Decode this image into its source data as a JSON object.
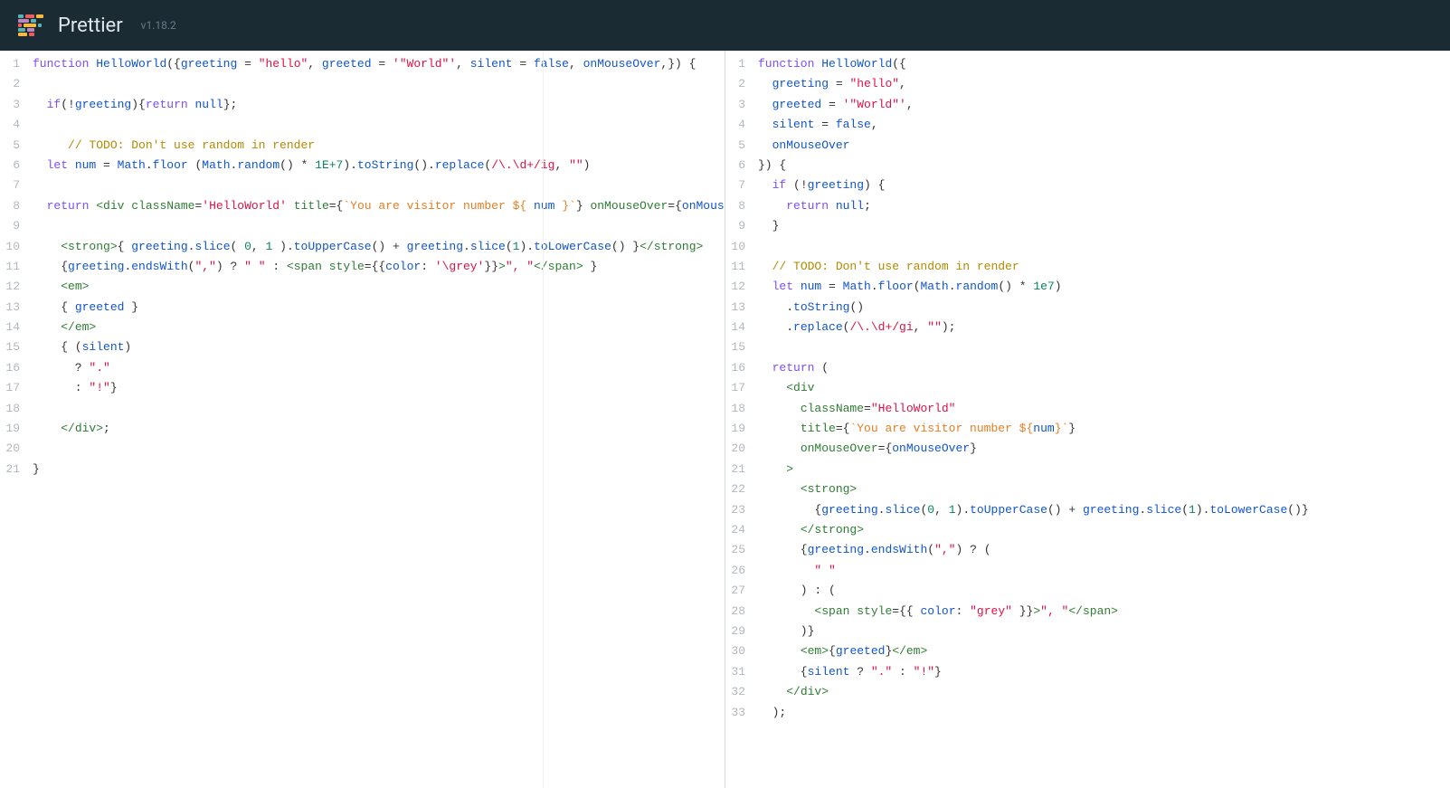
{
  "header": {
    "brand": "Prettier",
    "version": "v1.18.2"
  },
  "leftCode": [
    [
      [
        "kw",
        "function"
      ],
      [
        "op",
        " "
      ],
      [
        "fn",
        "HelloWorld"
      ],
      [
        "op",
        "({"
      ],
      [
        "id",
        "greeting"
      ],
      [
        "op",
        " = "
      ],
      [
        "str",
        "\"hello\""
      ],
      [
        "op",
        ", "
      ],
      [
        "id",
        "greeted"
      ],
      [
        "op",
        " = "
      ],
      [
        "str",
        "'\"World\"'"
      ],
      [
        "op",
        ", "
      ],
      [
        "id",
        "silent"
      ],
      [
        "op",
        " = "
      ],
      [
        "bool",
        "false"
      ],
      [
        "op",
        ", "
      ],
      [
        "id",
        "onMouseOver"
      ],
      [
        "op",
        ",}) {"
      ]
    ],
    [],
    [
      [
        "op",
        "  "
      ],
      [
        "kw",
        "if"
      ],
      [
        "op",
        "(!"
      ],
      [
        "id",
        "greeting"
      ],
      [
        "op",
        "){"
      ],
      [
        "kw",
        "return"
      ],
      [
        "op",
        " "
      ],
      [
        "bool",
        "null"
      ],
      [
        "op",
        "};"
      ]
    ],
    [],
    [
      [
        "op",
        "     "
      ],
      [
        "cm",
        "// TODO: Don't use random in render"
      ]
    ],
    [
      [
        "op",
        "  "
      ],
      [
        "kw",
        "let"
      ],
      [
        "op",
        " "
      ],
      [
        "id",
        "num"
      ],
      [
        "op",
        " = "
      ],
      [
        "id",
        "Math"
      ],
      [
        "op",
        "."
      ],
      [
        "prop",
        "floor"
      ],
      [
        "op",
        " ("
      ],
      [
        "id",
        "Math"
      ],
      [
        "op",
        "."
      ],
      [
        "prop",
        "random"
      ],
      [
        "op",
        "() * "
      ],
      [
        "num",
        "1E+7"
      ],
      [
        "op",
        ")."
      ],
      [
        "prop",
        "toString"
      ],
      [
        "op",
        "()."
      ],
      [
        "prop",
        "replace"
      ],
      [
        "op",
        "("
      ],
      [
        "regex",
        "/\\.\\d+/ig"
      ],
      [
        "op",
        ", "
      ],
      [
        "str",
        "\"\""
      ],
      [
        "op",
        ")"
      ]
    ],
    [],
    [
      [
        "op",
        "  "
      ],
      [
        "kw",
        "return"
      ],
      [
        "op",
        " "
      ],
      [
        "tag",
        "<div"
      ],
      [
        "op",
        " "
      ],
      [
        "attr",
        "className"
      ],
      [
        "op",
        "="
      ],
      [
        "str",
        "'HelloWorld'"
      ],
      [
        "op",
        " "
      ],
      [
        "attr",
        "title"
      ],
      [
        "op",
        "={"
      ],
      [
        "str2",
        "`You are visitor number ${"
      ],
      [
        "op",
        " "
      ],
      [
        "id",
        "num"
      ],
      [
        "op",
        " "
      ],
      [
        "str2",
        "}`"
      ],
      [
        "op",
        "} "
      ],
      [
        "attr",
        "onMouseOver"
      ],
      [
        "op",
        "={"
      ],
      [
        "id",
        "onMouseOver"
      ],
      [
        "op",
        "}"
      ],
      [
        "tag",
        ">"
      ]
    ],
    [],
    [
      [
        "op",
        "    "
      ],
      [
        "tag",
        "<strong>"
      ],
      [
        "op",
        "{ "
      ],
      [
        "id",
        "greeting"
      ],
      [
        "op",
        "."
      ],
      [
        "prop",
        "slice"
      ],
      [
        "op",
        "( "
      ],
      [
        "num",
        "0"
      ],
      [
        "op",
        ", "
      ],
      [
        "num",
        "1"
      ],
      [
        "op",
        " )."
      ],
      [
        "prop",
        "toUpperCase"
      ],
      [
        "op",
        "() + "
      ],
      [
        "id",
        "greeting"
      ],
      [
        "op",
        "."
      ],
      [
        "prop",
        "slice"
      ],
      [
        "op",
        "("
      ],
      [
        "num",
        "1"
      ],
      [
        "op",
        ")."
      ],
      [
        "prop",
        "toLowerCase"
      ],
      [
        "op",
        "() }"
      ],
      [
        "tag",
        "</strong>"
      ]
    ],
    [
      [
        "op",
        "    {"
      ],
      [
        "id",
        "greeting"
      ],
      [
        "op",
        "."
      ],
      [
        "prop",
        "endsWith"
      ],
      [
        "op",
        "("
      ],
      [
        "str",
        "\",\""
      ],
      [
        "op",
        ") ? "
      ],
      [
        "str",
        "\" \""
      ],
      [
        "op",
        " : "
      ],
      [
        "tag",
        "<span"
      ],
      [
        "op",
        " "
      ],
      [
        "attr",
        "style"
      ],
      [
        "op",
        "={{"
      ],
      [
        "id",
        "color"
      ],
      [
        "op",
        ": "
      ],
      [
        "str",
        "'\\grey'"
      ],
      [
        "op",
        "}}"
      ],
      [
        "tag",
        ">"
      ],
      [
        "str",
        "\", \""
      ],
      [
        "tag",
        "</span>"
      ],
      [
        "op",
        " }"
      ]
    ],
    [
      [
        "op",
        "    "
      ],
      [
        "tag",
        "<em>"
      ]
    ],
    [
      [
        "op",
        "    { "
      ],
      [
        "id",
        "greeted"
      ],
      [
        "op",
        " }"
      ]
    ],
    [
      [
        "op",
        "    "
      ],
      [
        "tag",
        "</em>"
      ]
    ],
    [
      [
        "op",
        "    { ("
      ],
      [
        "id",
        "silent"
      ],
      [
        "op",
        ")"
      ]
    ],
    [
      [
        "op",
        "      ? "
      ],
      [
        "str",
        "\".\""
      ]
    ],
    [
      [
        "op",
        "      : "
      ],
      [
        "str",
        "\"!\""
      ],
      [
        "op",
        "}"
      ]
    ],
    [],
    [
      [
        "op",
        "    "
      ],
      [
        "tag",
        "</div>"
      ],
      [
        "op",
        ";"
      ]
    ],
    [],
    [
      [
        "op",
        "}"
      ]
    ]
  ],
  "rightCode": [
    [
      [
        "kw",
        "function"
      ],
      [
        "op",
        " "
      ],
      [
        "fn",
        "HelloWorld"
      ],
      [
        "op",
        "({"
      ]
    ],
    [
      [
        "op",
        "  "
      ],
      [
        "id",
        "greeting"
      ],
      [
        "op",
        " = "
      ],
      [
        "str",
        "\"hello\""
      ],
      [
        "op",
        ","
      ]
    ],
    [
      [
        "op",
        "  "
      ],
      [
        "id",
        "greeted"
      ],
      [
        "op",
        " = "
      ],
      [
        "str",
        "'\"World\"'"
      ],
      [
        "op",
        ","
      ]
    ],
    [
      [
        "op",
        "  "
      ],
      [
        "id",
        "silent"
      ],
      [
        "op",
        " = "
      ],
      [
        "bool",
        "false"
      ],
      [
        "op",
        ","
      ]
    ],
    [
      [
        "op",
        "  "
      ],
      [
        "id",
        "onMouseOver"
      ]
    ],
    [
      [
        "op",
        "}) {"
      ]
    ],
    [
      [
        "op",
        "  "
      ],
      [
        "kw",
        "if"
      ],
      [
        "op",
        " (!"
      ],
      [
        "id",
        "greeting"
      ],
      [
        "op",
        ") {"
      ]
    ],
    [
      [
        "op",
        "    "
      ],
      [
        "kw",
        "return"
      ],
      [
        "op",
        " "
      ],
      [
        "bool",
        "null"
      ],
      [
        "op",
        ";"
      ]
    ],
    [
      [
        "op",
        "  }"
      ]
    ],
    [],
    [
      [
        "op",
        "  "
      ],
      [
        "cm",
        "// TODO: Don't use random in render"
      ]
    ],
    [
      [
        "op",
        "  "
      ],
      [
        "kw",
        "let"
      ],
      [
        "op",
        " "
      ],
      [
        "id",
        "num"
      ],
      [
        "op",
        " = "
      ],
      [
        "id",
        "Math"
      ],
      [
        "op",
        "."
      ],
      [
        "prop",
        "floor"
      ],
      [
        "op",
        "("
      ],
      [
        "id",
        "Math"
      ],
      [
        "op",
        "."
      ],
      [
        "prop",
        "random"
      ],
      [
        "op",
        "() * "
      ],
      [
        "num",
        "1e7"
      ],
      [
        "op",
        ")"
      ]
    ],
    [
      [
        "op",
        "    ."
      ],
      [
        "prop",
        "toString"
      ],
      [
        "op",
        "()"
      ]
    ],
    [
      [
        "op",
        "    ."
      ],
      [
        "prop",
        "replace"
      ],
      [
        "op",
        "("
      ],
      [
        "regex",
        "/\\.\\d+/gi"
      ],
      [
        "op",
        ", "
      ],
      [
        "str",
        "\"\""
      ],
      [
        "op",
        ");"
      ]
    ],
    [],
    [
      [
        "op",
        "  "
      ],
      [
        "kw",
        "return"
      ],
      [
        "op",
        " ("
      ]
    ],
    [
      [
        "op",
        "    "
      ],
      [
        "tag",
        "<div"
      ]
    ],
    [
      [
        "op",
        "      "
      ],
      [
        "attr",
        "className"
      ],
      [
        "op",
        "="
      ],
      [
        "str",
        "\"HelloWorld\""
      ]
    ],
    [
      [
        "op",
        "      "
      ],
      [
        "attr",
        "title"
      ],
      [
        "op",
        "={"
      ],
      [
        "str2",
        "`You are visitor number ${"
      ],
      [
        "id",
        "num"
      ],
      [
        "str2",
        "}`"
      ],
      [
        "op",
        "}"
      ]
    ],
    [
      [
        "op",
        "      "
      ],
      [
        "attr",
        "onMouseOver"
      ],
      [
        "op",
        "={"
      ],
      [
        "id",
        "onMouseOver"
      ],
      [
        "op",
        "}"
      ]
    ],
    [
      [
        "op",
        "    "
      ],
      [
        "tag",
        ">"
      ]
    ],
    [
      [
        "op",
        "      "
      ],
      [
        "tag",
        "<strong>"
      ]
    ],
    [
      [
        "op",
        "        {"
      ],
      [
        "id",
        "greeting"
      ],
      [
        "op",
        "."
      ],
      [
        "prop",
        "slice"
      ],
      [
        "op",
        "("
      ],
      [
        "num",
        "0"
      ],
      [
        "op",
        ", "
      ],
      [
        "num",
        "1"
      ],
      [
        "op",
        ")."
      ],
      [
        "prop",
        "toUpperCase"
      ],
      [
        "op",
        "() + "
      ],
      [
        "id",
        "greeting"
      ],
      [
        "op",
        "."
      ],
      [
        "prop",
        "slice"
      ],
      [
        "op",
        "("
      ],
      [
        "num",
        "1"
      ],
      [
        "op",
        ")."
      ],
      [
        "prop",
        "toLowerCase"
      ],
      [
        "op",
        "()}"
      ]
    ],
    [
      [
        "op",
        "      "
      ],
      [
        "tag",
        "</strong>"
      ]
    ],
    [
      [
        "op",
        "      {"
      ],
      [
        "id",
        "greeting"
      ],
      [
        "op",
        "."
      ],
      [
        "prop",
        "endsWith"
      ],
      [
        "op",
        "("
      ],
      [
        "str",
        "\",\""
      ],
      [
        "op",
        ") ? ("
      ]
    ],
    [
      [
        "op",
        "        "
      ],
      [
        "str",
        "\" \""
      ]
    ],
    [
      [
        "op",
        "      ) : ("
      ]
    ],
    [
      [
        "op",
        "        "
      ],
      [
        "tag",
        "<span"
      ],
      [
        "op",
        " "
      ],
      [
        "attr",
        "style"
      ],
      [
        "op",
        "={{ "
      ],
      [
        "id",
        "color"
      ],
      [
        "op",
        ": "
      ],
      [
        "str",
        "\"grey\""
      ],
      [
        "op",
        " }}"
      ],
      [
        "tag",
        ">"
      ],
      [
        "str",
        "\", \""
      ],
      [
        "tag",
        "</span>"
      ]
    ],
    [
      [
        "op",
        "      )}"
      ]
    ],
    [
      [
        "op",
        "      "
      ],
      [
        "tag",
        "<em>"
      ],
      [
        "op",
        "{"
      ],
      [
        "id",
        "greeted"
      ],
      [
        "op",
        "}"
      ],
      [
        "tag",
        "</em>"
      ]
    ],
    [
      [
        "op",
        "      {"
      ],
      [
        "id",
        "silent"
      ],
      [
        "op",
        " ? "
      ],
      [
        "str",
        "\".\""
      ],
      [
        "op",
        " : "
      ],
      [
        "str",
        "\"!\""
      ],
      [
        "op",
        "}"
      ]
    ],
    [
      [
        "op",
        "    "
      ],
      [
        "tag",
        "</div>"
      ]
    ],
    [
      [
        "op",
        "  );"
      ]
    ]
  ]
}
